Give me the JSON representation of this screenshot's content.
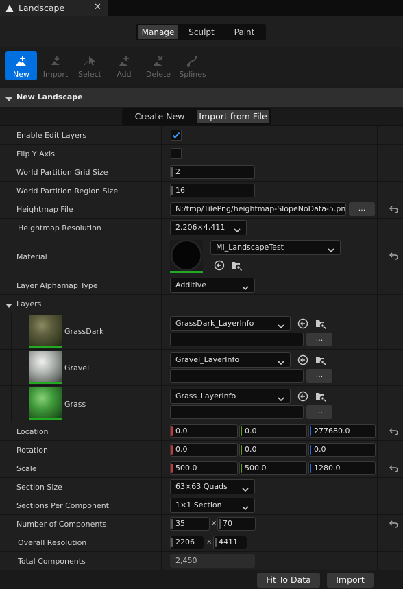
{
  "window": {
    "tab_title": "Landscape"
  },
  "modes": {
    "items": [
      "Manage",
      "Sculpt",
      "Paint"
    ],
    "active": "Manage"
  },
  "toolbar": {
    "new": "New",
    "import": "Import",
    "select": "Select",
    "add": "Add",
    "delete": "Delete",
    "splines": "Splines"
  },
  "section": {
    "title": "New Landscape"
  },
  "source": {
    "create_new": "Create New",
    "import_from_file": "Import from File"
  },
  "props": {
    "enable_edit_layers": {
      "label": "Enable Edit Layers",
      "checked": true
    },
    "flip_y_axis": {
      "label": "Flip Y Axis",
      "checked": false
    },
    "wp_grid_size": {
      "label": "World Partition Grid Size",
      "value": "2"
    },
    "wp_region_size": {
      "label": "World Partition Region Size",
      "value": "16"
    },
    "heightmap_file": {
      "label": "Heightmap File",
      "value": "N:/tmp/TilePng/heightmap-SlopeNoData-5.png",
      "browse": "..."
    },
    "heightmap_resolution": {
      "label": "Heightmap Resolution",
      "value": "2,206×4,411"
    },
    "material": {
      "label": "Material",
      "value": "MI_LandscapeTest"
    },
    "layer_alphamap_type": {
      "label": "Layer Alphamap Type",
      "value": "Additive"
    },
    "layers_header": {
      "label": "Layers"
    },
    "location": {
      "label": "Location",
      "x": "0.0",
      "y": "0.0",
      "z": "277680.0"
    },
    "rotation": {
      "label": "Rotation",
      "x": "0.0",
      "y": "0.0",
      "z": "0.0"
    },
    "scale": {
      "label": "Scale",
      "x": "500.0",
      "y": "500.0",
      "z": "1280.0"
    },
    "section_size": {
      "label": "Section Size",
      "value": "63×63 Quads"
    },
    "sections_per_component": {
      "label": "Sections Per Component",
      "value": "1×1 Section"
    },
    "num_components": {
      "label": "Number of Components",
      "x": "35",
      "times": "×",
      "y": "70"
    },
    "overall_resolution": {
      "label": "Overall Resolution",
      "x": "2206",
      "times": "×",
      "y": "4411"
    },
    "total_components": {
      "label": "Total Components",
      "value": "2,450"
    }
  },
  "layers": [
    {
      "name": "GrassDark",
      "info": "GrassDark_LayerInfo",
      "browse": "..."
    },
    {
      "name": "Gravel",
      "info": "Gravel_LayerInfo",
      "browse": "..."
    },
    {
      "name": "Grass",
      "info": "Grass_LayerInfo",
      "browse": "..."
    }
  ],
  "footer": {
    "fit_to_data": "Fit To Data",
    "import": "Import"
  },
  "colors": {
    "accent": "#0070e0",
    "x_axis": "#c43a3a",
    "y_axis": "#6aa121",
    "z_axis": "#2f6bd6",
    "check": "#3d9dff",
    "thumb_bar": "#22aa22"
  }
}
